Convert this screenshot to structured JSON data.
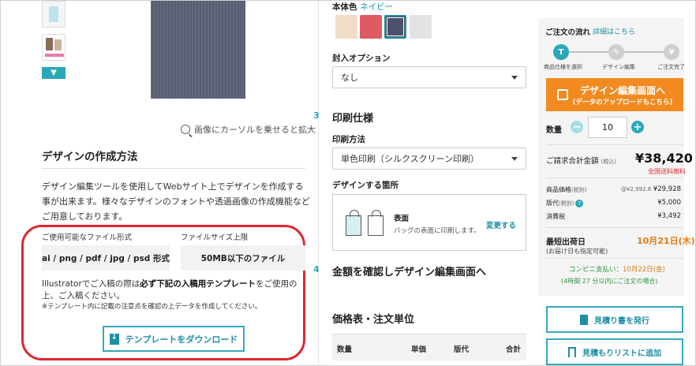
{
  "left": {
    "zoom_hint": "画像にカーソルを乗せると拡大",
    "section_title": "デザインの作成方法",
    "description": "デザイン編集ツールを使用してWebサイト上でデザインを作成する事が出来ます。様々なデザインのフォントや透過画像の作成機能などご用意しております。",
    "file_format_label": "ご使用可能なファイル形式",
    "file_format_value": "ai / png / pdf / jpg / psd 形式",
    "file_size_label": "ファイルサイズ上限",
    "file_size_value": "50MB以下のファイル",
    "note_pre": "Illustratorでご入稿の際は",
    "note_bold": "必ず下記の入稿用テンプレート",
    "note_post": "をご使用の上、ご入稿ください。",
    "note_small": "※テンプレート内に記載の注意点を確認の上データを作成してください。",
    "download_button": "テンプレートをダウンロード"
  },
  "middle": {
    "body_color_label": "本体色",
    "body_color_value": "ネイビー",
    "swatches": [
      {
        "name": "natural",
        "color": "#f0dcc8"
      },
      {
        "name": "red",
        "color": "#e05a63"
      },
      {
        "name": "navy",
        "color": "#4b526a",
        "selected": true
      },
      {
        "name": "light-gray",
        "color": "#e3e3e3"
      }
    ],
    "enclosure_label": "封入オプション",
    "enclosure_value": "なし",
    "step3_num": "3",
    "step3_title": "印刷仕様",
    "print_method_label": "印刷方法",
    "print_method_value": "単色印刷（シルクスクリーン印刷）",
    "design_place_label": "デザインする箇所",
    "place_title": "表面",
    "place_sub": "バッグの表面に印刷します。",
    "place_change": "変更する",
    "step4_num": "4",
    "step4_title": "金額を確認しデザイン編集画面へ",
    "price_table_title": "価格表・注文単位",
    "table_headers": [
      "数量",
      "単価",
      "版代",
      "合計"
    ]
  },
  "right": {
    "flow_title": "ご注文の流れ",
    "flow_link": "詳細はこちら",
    "flow_steps": [
      "商品仕様を選択",
      "デザイン編集",
      "ご注文完了"
    ],
    "cta_main": "デザイン編集画面へ",
    "cta_sub": "(データのアップロードもこちら)",
    "qty_label": "数量",
    "qty_value": "10",
    "total_label": "ご請求合計金額",
    "total_tax": "(税込)",
    "total_value": "¥38,420",
    "free_shipping": "全国送料無料",
    "rows": [
      {
        "label": "商品価格",
        "label_small": "(税別)",
        "value_small": "@¥2,992.8",
        "value": "¥29,928"
      },
      {
        "label": "版代",
        "label_small": "(税別)",
        "value_small": "",
        "value": "¥5,000",
        "help": "?"
      },
      {
        "label": "消費税",
        "label_small": "",
        "value_small": "",
        "value": "¥3,492"
      }
    ],
    "ship_label": "最短出荷日",
    "ship_sub": "(お届け日も指定可能)",
    "ship_date": "10月21日(木)",
    "conv_pre": "コンビニ支払い：",
    "conv_date": "10月22日(金)",
    "conv_note": "(4時間 27 分以内にご注文の場合)",
    "quote_button": "見積り書を発行",
    "list_button": "見積もりリストに追加"
  },
  "colors": {
    "accent": "#2aa8b9",
    "cta": "#f28a1f",
    "alert": "#e0262e",
    "ship": "#e07b12",
    "conv": "#2e9a3d"
  }
}
